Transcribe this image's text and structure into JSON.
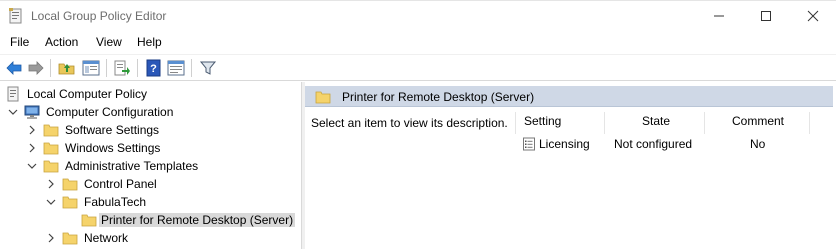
{
  "window": {
    "title": "Local Group Policy Editor"
  },
  "menu": [
    "File",
    "Action",
    "View",
    "Help"
  ],
  "toolbar": [
    "back-icon",
    "forward-icon",
    "up-folder-icon",
    "show-hide-tree-icon",
    "export-list-icon",
    "help-icon",
    "properties-icon",
    "filter-icon"
  ],
  "tree": [
    {
      "label": "Local Computer Policy",
      "icon": "policy-icon",
      "expander": "none"
    },
    {
      "label": "Computer Configuration",
      "icon": "computer-icon",
      "expander": "expanded"
    },
    {
      "label": "Software Settings",
      "icon": "folder-icon",
      "expander": "collapsed"
    },
    {
      "label": "Windows Settings",
      "icon": "folder-icon",
      "expander": "collapsed"
    },
    {
      "label": "Administrative Templates",
      "icon": "folder-icon",
      "expander": "expanded"
    },
    {
      "label": "Control Panel",
      "icon": "folder-icon",
      "expander": "collapsed"
    },
    {
      "label": "FabulaTech",
      "icon": "folder-icon",
      "expander": "expanded"
    },
    {
      "label": "Printer for Remote Desktop (Server)",
      "icon": "folder-icon",
      "expander": "none",
      "selected": true
    },
    {
      "label": "Network",
      "icon": "folder-icon",
      "expander": "collapsed"
    }
  ],
  "right": {
    "header": "Printer for Remote Desktop (Server)",
    "description": "Select an item to view its description.",
    "columns": [
      "Setting",
      "State",
      "Comment"
    ],
    "rows": [
      {
        "setting": "Licensing",
        "state": "Not configured",
        "comment": "No"
      }
    ]
  },
  "colors": {
    "header_bg": "#cfd8e6",
    "selected_bg": "#d9d9d9",
    "folder": "#f5d36b"
  }
}
